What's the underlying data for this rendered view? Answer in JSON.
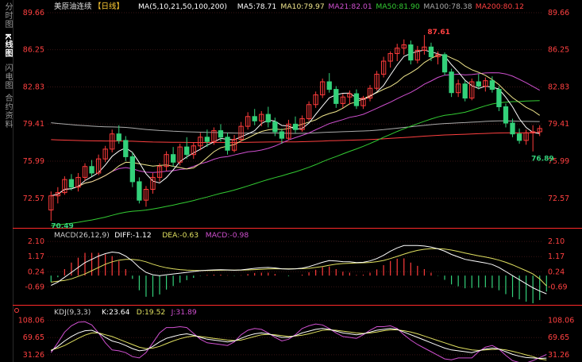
{
  "sidebar": {
    "tabs": [
      {
        "label": "分时图",
        "active": false
      },
      {
        "label": "K线图",
        "active": true
      },
      {
        "label": "闪电图",
        "active": false
      },
      {
        "label": "合约资料",
        "active": false
      }
    ]
  },
  "colors": {
    "up": "#ff3b3b",
    "down": "#33d17a",
    "ma5": "#ffffff",
    "ma10": "#f0e68c",
    "ma21": "#d050d0",
    "ma50": "#33cc33",
    "ma100": "#aaaaaa",
    "ma200": "#ff4040",
    "diff": "#ffffff",
    "dea": "#e0e060",
    "macd_line": "#d050d0",
    "k": "#ffffff",
    "d": "#e0e060",
    "j": "#d050d0",
    "price_axis": "#ff4040",
    "grid": "#3a1515",
    "separator": "#ff2a2a"
  },
  "chart_data": [
    {
      "type": "candlestick",
      "title": "美原油连续",
      "period": "【日线】",
      "legend": [
        {
          "text": "MA(5,10,21,50,100,200)",
          "color": "#ffffff"
        },
        {
          "text": "MA5:78.71",
          "color": "#ffffff"
        },
        {
          "text": "MA10:79.97",
          "color": "#f0e68c"
        },
        {
          "text": "MA21:82.01",
          "color": "#d050d0"
        },
        {
          "text": "MA50:81.90",
          "color": "#33cc33"
        },
        {
          "text": "MA100:78.38",
          "color": "#aaaaaa"
        },
        {
          "text": "MA200:80.12",
          "color": "#ff4040"
        }
      ],
      "yticks": [
        "89.66",
        "86.25",
        "82.83",
        "79.41",
        "75.99",
        "72.57"
      ],
      "ylim": [
        70.0,
        89.66
      ],
      "annotations": {
        "high": "87.61",
        "low_left": "70.49",
        "low_right": "76.89"
      },
      "candles": [
        [
          71.5,
          73.2,
          70.49,
          72.8
        ],
        [
          72.8,
          73.6,
          72.1,
          73.1
        ],
        [
          73.1,
          74.6,
          72.9,
          74.3
        ],
        [
          74.3,
          74.8,
          73.3,
          73.6
        ],
        [
          73.6,
          74.9,
          73.2,
          74.5
        ],
        [
          74.5,
          75.8,
          74.2,
          75.5
        ],
        [
          75.5,
          76.1,
          74.6,
          74.9
        ],
        [
          74.9,
          76.6,
          74.7,
          76.2
        ],
        [
          76.2,
          77.4,
          75.9,
          77.1
        ],
        [
          77.1,
          78.9,
          76.8,
          78.5
        ],
        [
          78.5,
          79.3,
          77.6,
          77.9
        ],
        [
          77.9,
          78.3,
          76.0,
          76.4
        ],
        [
          76.4,
          76.8,
          73.6,
          74.1
        ],
        [
          74.1,
          74.5,
          72.1,
          72.4
        ],
        [
          72.4,
          73.7,
          71.8,
          73.4
        ],
        [
          73.4,
          74.9,
          73.0,
          74.5
        ],
        [
          74.5,
          75.8,
          74.1,
          75.5
        ],
        [
          75.5,
          76.9,
          75.1,
          76.6
        ],
        [
          76.6,
          77.3,
          75.5,
          75.9
        ],
        [
          75.9,
          77.6,
          75.6,
          77.3
        ],
        [
          77.3,
          78.2,
          76.2,
          76.6
        ],
        [
          76.6,
          77.7,
          76.2,
          77.4
        ],
        [
          77.4,
          78.6,
          77.0,
          78.2
        ],
        [
          78.2,
          78.9,
          77.3,
          77.8
        ],
        [
          77.8,
          79.1,
          77.5,
          78.8
        ],
        [
          78.8,
          79.4,
          77.8,
          78.2
        ],
        [
          78.2,
          78.6,
          76.6,
          77.0
        ],
        [
          77.0,
          78.4,
          76.8,
          78.0
        ],
        [
          78.0,
          79.6,
          77.8,
          79.2
        ],
        [
          79.2,
          80.5,
          78.9,
          80.1
        ],
        [
          80.1,
          80.8,
          79.3,
          79.7
        ],
        [
          79.7,
          80.6,
          79.2,
          80.3
        ],
        [
          80.3,
          81.0,
          79.1,
          79.6
        ],
        [
          79.6,
          80.0,
          78.3,
          78.7
        ],
        [
          78.7,
          79.0,
          77.6,
          78.1
        ],
        [
          78.1,
          79.8,
          77.9,
          79.4
        ],
        [
          79.4,
          80.1,
          78.6,
          78.9
        ],
        [
          78.9,
          80.2,
          78.7,
          79.9
        ],
        [
          79.9,
          81.5,
          79.7,
          81.2
        ],
        [
          81.2,
          82.4,
          80.9,
          82.1
        ],
        [
          82.1,
          83.6,
          81.8,
          83.3
        ],
        [
          83.3,
          84.1,
          82.3,
          82.6
        ],
        [
          82.6,
          82.9,
          80.9,
          81.3
        ],
        [
          81.3,
          82.2,
          80.9,
          81.9
        ],
        [
          81.9,
          82.5,
          81.2,
          82.2
        ],
        [
          82.2,
          82.6,
          80.8,
          81.1
        ],
        [
          81.1,
          82.0,
          80.8,
          81.8
        ],
        [
          81.8,
          83.0,
          81.5,
          82.7
        ],
        [
          82.7,
          84.3,
          82.5,
          84.0
        ],
        [
          84.0,
          85.6,
          83.7,
          85.2
        ],
        [
          85.2,
          86.1,
          84.6,
          85.9
        ],
        [
          85.9,
          86.8,
          85.2,
          86.4
        ],
        [
          86.4,
          87.2,
          85.8,
          86.7
        ],
        [
          86.7,
          87.1,
          84.9,
          85.3
        ],
        [
          85.3,
          86.6,
          85.0,
          86.2
        ],
        [
          86.2,
          87.61,
          85.8,
          86.5
        ],
        [
          86.5,
          86.9,
          85.2,
          85.6
        ],
        [
          85.6,
          86.1,
          84.9,
          85.8
        ],
        [
          85.8,
          86.0,
          83.9,
          84.2
        ],
        [
          84.2,
          84.5,
          81.9,
          82.3
        ],
        [
          82.3,
          83.5,
          81.9,
          83.1
        ],
        [
          83.1,
          83.4,
          81.5,
          81.8
        ],
        [
          81.8,
          83.6,
          81.6,
          83.3
        ],
        [
          83.3,
          84.0,
          82.6,
          82.9
        ],
        [
          82.9,
          83.7,
          82.4,
          83.4
        ],
        [
          83.4,
          83.8,
          82.3,
          82.6
        ],
        [
          82.6,
          82.9,
          80.6,
          81.0
        ],
        [
          81.0,
          81.3,
          79.1,
          79.5
        ],
        [
          79.5,
          79.9,
          78.2,
          78.5
        ],
        [
          78.5,
          79.0,
          77.6,
          77.9
        ],
        [
          77.9,
          78.9,
          77.5,
          78.6
        ],
        [
          78.6,
          79.3,
          76.89,
          78.7
        ],
        [
          78.7,
          79.3,
          78.3,
          79.0
        ]
      ]
    },
    {
      "type": "macd",
      "legend": [
        {
          "text": "MACD(26,12,9)",
          "color": "#cccccc"
        },
        {
          "text": "DIFF:-1.12",
          "color": "#ffffff"
        },
        {
          "text": "DEA:-0.63",
          "color": "#e0e060"
        },
        {
          "text": "MACD:-0.98",
          "color": "#d050d0"
        }
      ],
      "yticks": [
        "2.10",
        "1.17",
        "0.24",
        "-0.69"
      ],
      "ylim": [
        -1.7,
        2.4
      ],
      "diff": [
        -0.6,
        -0.4,
        -0.1,
        0.2,
        0.5,
        0.8,
        1.0,
        1.2,
        1.35,
        1.45,
        1.4,
        1.2,
        0.9,
        0.5,
        0.2,
        0.05,
        0.0,
        0.05,
        0.1,
        0.15,
        0.2,
        0.25,
        0.3,
        0.33,
        0.35,
        0.36,
        0.35,
        0.33,
        0.35,
        0.4,
        0.45,
        0.48,
        0.5,
        0.47,
        0.42,
        0.4,
        0.42,
        0.46,
        0.55,
        0.68,
        0.82,
        0.92,
        0.9,
        0.86,
        0.85,
        0.8,
        0.82,
        0.9,
        1.05,
        1.25,
        1.5,
        1.7,
        1.85,
        1.85,
        1.85,
        1.82,
        1.75,
        1.65,
        1.5,
        1.3,
        1.15,
        1.0,
        0.92,
        0.85,
        0.78,
        0.68,
        0.5,
        0.25,
        0.0,
        -0.25,
        -0.5,
        -0.75,
        -0.95,
        -1.12
      ],
      "dea": [
        -0.4,
        -0.35,
        -0.3,
        -0.2,
        -0.05,
        0.1,
        0.3,
        0.5,
        0.7,
        0.85,
        0.95,
        1.0,
        1.0,
        0.95,
        0.85,
        0.7,
        0.58,
        0.48,
        0.42,
        0.37,
        0.34,
        0.32,
        0.31,
        0.31,
        0.32,
        0.33,
        0.34,
        0.34,
        0.34,
        0.35,
        0.37,
        0.39,
        0.41,
        0.42,
        0.42,
        0.42,
        0.42,
        0.43,
        0.45,
        0.5,
        0.56,
        0.64,
        0.7,
        0.74,
        0.76,
        0.78,
        0.79,
        0.81,
        0.86,
        0.93,
        1.05,
        1.18,
        1.32,
        1.45,
        1.55,
        1.62,
        1.66,
        1.66,
        1.63,
        1.57,
        1.48,
        1.39,
        1.3,
        1.22,
        1.14,
        1.06,
        0.95,
        0.82,
        0.66,
        0.48,
        0.3,
        0.1,
        -0.2,
        -0.63
      ]
    },
    {
      "type": "kdj",
      "legend": [
        {
          "text": "KDJ(9,3,3)",
          "color": "#cccccc"
        },
        {
          "text": "K:23.64",
          "color": "#ffffff"
        },
        {
          "text": "D:19.52",
          "color": "#e0e060"
        },
        {
          "text": "J:31.89",
          "color": "#d050d0"
        }
      ],
      "yticks": [
        "108.06",
        "69.65",
        "31.26"
      ],
      "ylim": [
        15,
        118
      ],
      "k": [
        40,
        50,
        62,
        72,
        80,
        85,
        86,
        80,
        70,
        62,
        58,
        52,
        45,
        40,
        42,
        50,
        60,
        68,
        72,
        76,
        78,
        75,
        70,
        66,
        64,
        62,
        60,
        62,
        68,
        74,
        78,
        80,
        78,
        74,
        70,
        70,
        74,
        80,
        84,
        88,
        90,
        88,
        84,
        80,
        78,
        76,
        78,
        82,
        86,
        88,
        90,
        88,
        82,
        76,
        70,
        64,
        58,
        52,
        46,
        42,
        40,
        38,
        36,
        40,
        44,
        46,
        44,
        38,
        32,
        28,
        25,
        24,
        23,
        23.64
      ],
      "d": [
        42,
        46,
        52,
        60,
        68,
        75,
        80,
        80,
        76,
        72,
        66,
        60,
        54,
        48,
        45,
        46,
        50,
        56,
        62,
        67,
        71,
        73,
        72,
        70,
        68,
        66,
        64,
        63,
        64,
        68,
        72,
        76,
        77,
        76,
        74,
        72,
        73,
        75,
        78,
        82,
        86,
        87,
        86,
        84,
        82,
        80,
        79,
        80,
        82,
        85,
        87,
        87,
        85,
        82,
        78,
        73,
        68,
        63,
        58,
        53,
        48,
        45,
        42,
        41,
        42,
        43,
        44,
        42,
        39,
        35,
        31,
        27,
        22,
        19.52
      ],
      "j": [
        36,
        58,
        82,
        96,
        104,
        105,
        98,
        80,
        58,
        42,
        40,
        36,
        27,
        24,
        36,
        58,
        80,
        92,
        92,
        94,
        92,
        79,
        66,
        58,
        56,
        54,
        52,
        60,
        76,
        86,
        90,
        88,
        80,
        70,
        62,
        66,
        76,
        90,
        96,
        100,
        98,
        90,
        80,
        72,
        70,
        68,
        76,
        86,
        94,
        94,
        96,
        90,
        76,
        64,
        54,
        46,
        38,
        30,
        22,
        20,
        24,
        24,
        24,
        38,
        48,
        52,
        44,
        30,
        18,
        14,
        13,
        18,
        25,
        31.89
      ]
    }
  ]
}
